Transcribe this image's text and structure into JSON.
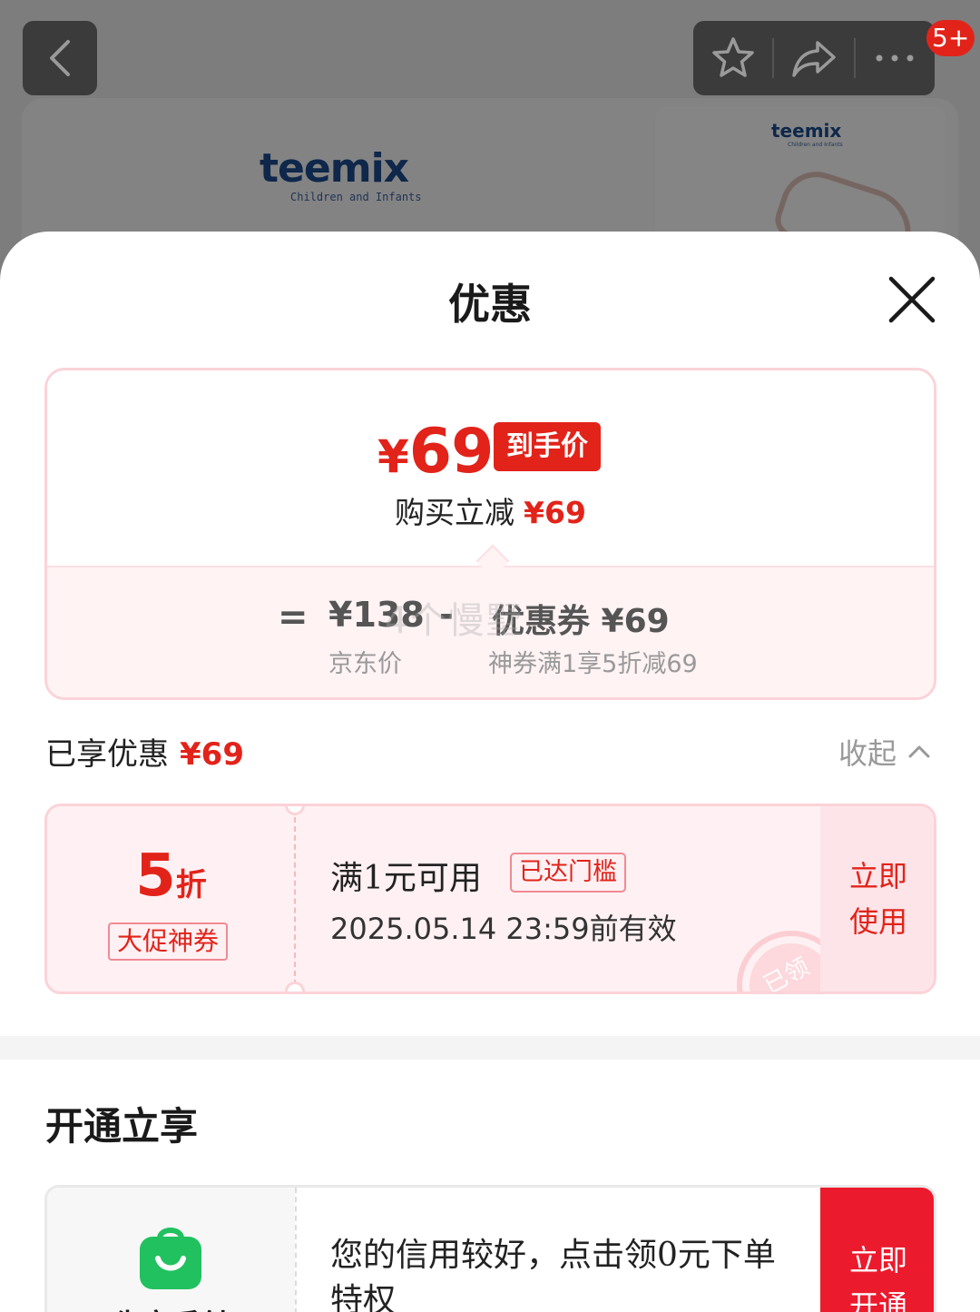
{
  "background": {
    "brand_logo": "teemix",
    "brand_tagline": "Children and Infants",
    "notification_badge": "5+"
  },
  "sheet": {
    "title": "优惠"
  },
  "price_summary": {
    "currency": "¥",
    "final_price": "69",
    "final_price_tag": "到手价",
    "reduce_label": "购买立减",
    "reduce_amount": "¥69",
    "equals": "=",
    "original_price": "¥138",
    "original_label": "京东价",
    "minus": "-",
    "coupon_value": "优惠券 ¥69",
    "coupon_desc": "神券满1享5折减69",
    "watermark": "4个慢墅"
  },
  "enjoyed": {
    "label": "已享优惠",
    "amount": "¥69",
    "collapse_label": "收起"
  },
  "coupon": {
    "discount_number": "5",
    "discount_unit": "折",
    "tag": "大促神券",
    "condition": "满1元可用",
    "reached_tag": "已达门槛",
    "validity": "2025.05.14 23:59前有效",
    "stamp": "已领",
    "action": "立即\n使用"
  },
  "open_section": {
    "title": "开通立享",
    "card": {
      "name": "先享后付",
      "text": "您的信用较好，点击领0元下单特权",
      "action": "立即\n开通"
    }
  },
  "colors": {
    "accent_red": "#e2231a",
    "coupon_bg": "#fff1f3",
    "coupon_border": "#fbd3d8",
    "green_icon": "#21c160"
  }
}
